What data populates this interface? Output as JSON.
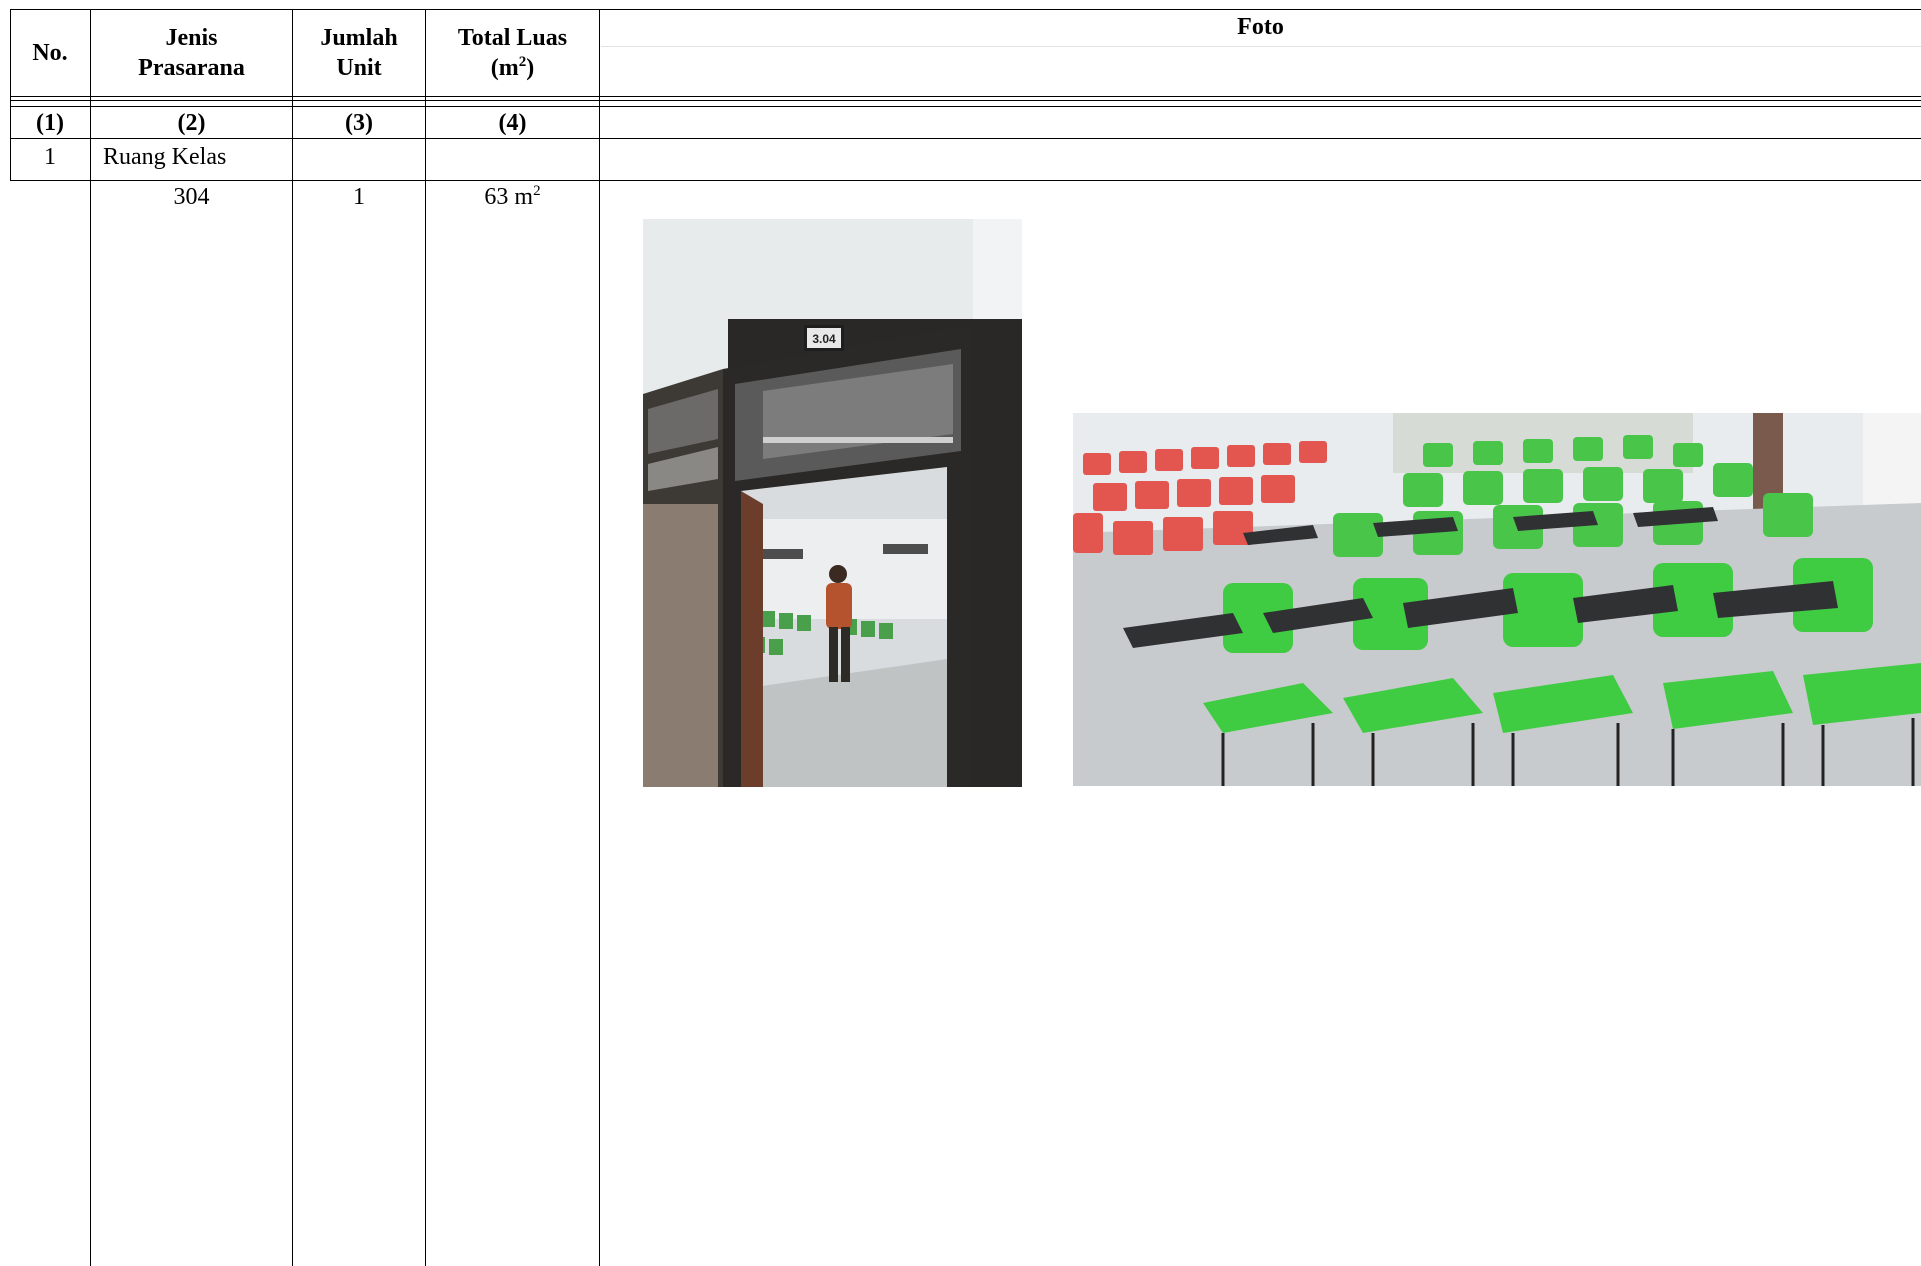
{
  "table": {
    "headers": {
      "no": "No.",
      "jenis_line1": "Jenis",
      "jenis_line2": "Prasarana",
      "jumlah_line1": "Jumlah",
      "jumlah_line2": "Unit",
      "luas_line1": "Total Luas",
      "luas_unit_open": "(m",
      "luas_unit_sup": "2",
      "luas_unit_close": ")",
      "foto": "Foto"
    },
    "column_numbers": [
      "(1)",
      "(2)",
      "(3)",
      "(4)"
    ],
    "rows": [
      {
        "no": "1",
        "jenis": "Ruang Kelas"
      }
    ],
    "sub_rows": [
      {
        "jenis": "304",
        "jumlah": "1",
        "luas_value": "63 m",
        "luas_sup": "2"
      }
    ]
  },
  "photos": [
    {
      "icon": "classroom-door-photo",
      "sign_text": "3.04"
    },
    {
      "icon": "classroom-chairs-photo"
    }
  ]
}
